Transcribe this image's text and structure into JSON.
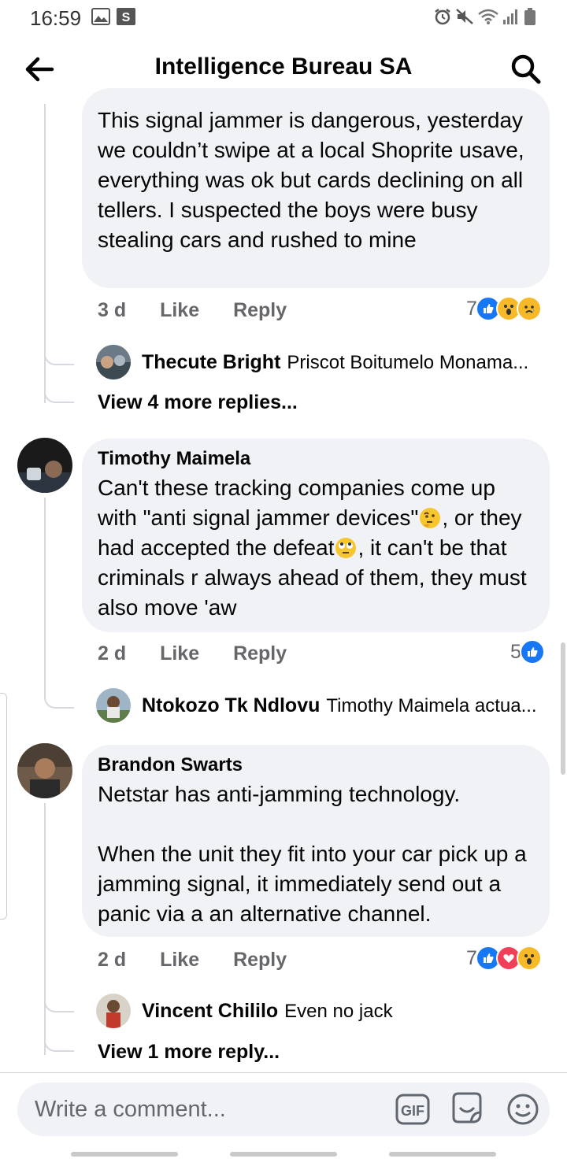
{
  "status": {
    "time": "16:59"
  },
  "header": {
    "title": "Intelligence Bureau SA"
  },
  "comments": [
    {
      "text": "This signal jammer is dangerous, yesterday we couldn’t swipe at a local Shoprite usave, everything was ok but cards declining on all tellers. I suspected the boys were busy stealing cars and rushed to mine",
      "time": "3 d",
      "like": "Like",
      "reply": "Reply",
      "reactions_count": "7",
      "reply_preview": {
        "name": "Thecute Bright",
        "text": "Priscot Boitumelo Monama..."
      },
      "view_more": "View 4 more replies..."
    },
    {
      "author": "Timothy Maimela",
      "text_parts": [
        "Can't these tracking companies come up with \"anti signal jammer devices\"",
        ", or they had accepted the defeat",
        ", it can't be that criminals r always ahead of them, they must also move 'aw"
      ],
      "time": "2 d",
      "like": "Like",
      "reply": "Reply",
      "reactions_count": "5",
      "reply_preview": {
        "name": "Ntokozo Tk Ndlovu",
        "text": "Timothy Maimela actua..."
      }
    },
    {
      "author": "Brandon Swarts",
      "text": "Netstar has anti-jamming technology.\n\nWhen the unit they fit into your car pick up a jamming signal, it immediately send out a panic via a an alternative channel.",
      "time": "2 d",
      "like": "Like",
      "reply": "Reply",
      "reactions_count": "7",
      "reply_preview": {
        "name": "Vincent Chililo",
        "text": "Even no jack"
      },
      "view_more": "View 1 more reply..."
    }
  ],
  "composer": {
    "placeholder": "Write a comment...",
    "gif_label": "GIF"
  },
  "colors": {
    "bubble": "#f0f2f5",
    "like_blue": "#1877f2",
    "meta_gray": "#65676b"
  }
}
